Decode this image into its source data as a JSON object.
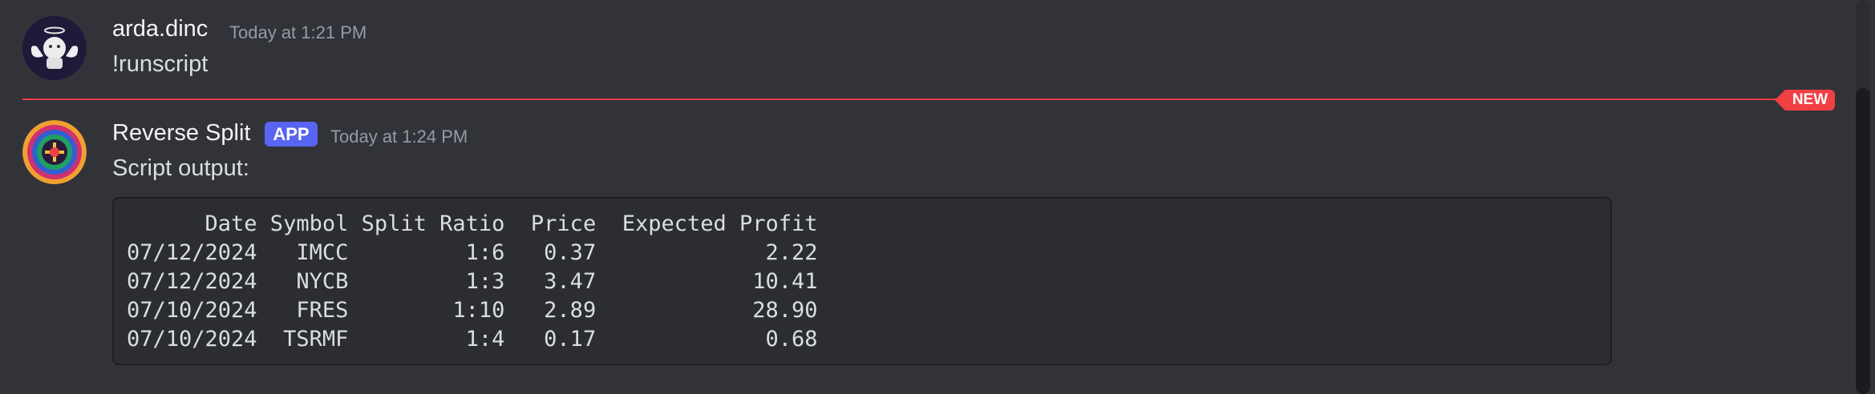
{
  "messages": [
    {
      "author": "arda.dinc",
      "timestamp": "Today at 1:21 PM",
      "text": "!runscript"
    },
    {
      "author": "Reverse Split",
      "badge": "APP",
      "timestamp": "Today at 1:24 PM",
      "text": "Script output:",
      "code": {
        "header": "      Date Symbol Split Ratio  Price  Expected Profit",
        "rows": [
          "07/12/2024   IMCC         1:6   0.37             2.22",
          "07/12/2024   NYCB         1:3   3.47            10.41",
          "07/10/2024   FRES        1:10   2.89            28.90",
          "07/10/2024  TSRMF         1:4   0.17             0.68"
        ]
      }
    }
  ],
  "divider": {
    "label": "NEW"
  },
  "colors": {
    "background": "#313338",
    "accent": "#5865f2",
    "new_divider": "#f23f43",
    "code_background": "#2b2d31"
  },
  "icons": {
    "avatar_1": "angel-robot-avatar",
    "avatar_2": "colorful-logo-avatar"
  }
}
